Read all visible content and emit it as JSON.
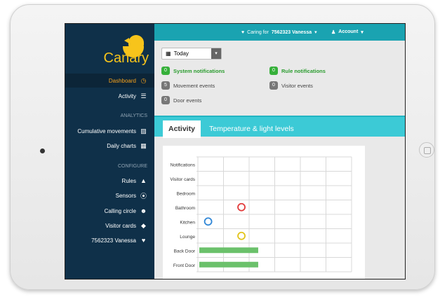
{
  "brand": {
    "name": "Canary",
    "color": "#f7c41b"
  },
  "topbar": {
    "caring_prefix": "Caring for",
    "caring_name": "7562323 Vanessa",
    "account_label": "Account",
    "color": "#1aa3b1"
  },
  "sidebar": {
    "items": [
      {
        "label": "Dashboard",
        "icon": "dashboard-icon"
      },
      {
        "label": "Activity",
        "icon": "activity-bars-icon"
      },
      {
        "label": "Cumulative movements",
        "icon": "line-chart-icon"
      },
      {
        "label": "Daily charts",
        "icon": "calendar-icon"
      },
      {
        "label": "Rules",
        "icon": "bell-icon"
      },
      {
        "label": "Sensors",
        "icon": "sensor-icon"
      },
      {
        "label": "Calling circle",
        "icon": "people-icon"
      },
      {
        "label": "Visitor cards",
        "icon": "tags-icon"
      },
      {
        "label": "7562323 Vanessa",
        "icon": "heart-icon"
      }
    ],
    "headings": {
      "analytics": "ANALYTICS",
      "configure": "CONFIGURE"
    }
  },
  "filters": {
    "date_value": "Today"
  },
  "stats": [
    {
      "count": "0",
      "label": "System notifications",
      "style": "green"
    },
    {
      "count": "0",
      "label": "Rule notifications",
      "style": "green"
    },
    {
      "count": "5",
      "label": "Movement events",
      "style": "gray"
    },
    {
      "count": "0",
      "label": "Visitor events",
      "style": "gray"
    },
    {
      "count": "0",
      "label": "Door events",
      "style": "gray"
    }
  ],
  "tabs": [
    {
      "label": "Activity",
      "active": true
    },
    {
      "label": "Temperature & light levels",
      "active": false
    }
  ],
  "chart_data": {
    "type": "scatter",
    "categories": [
      "Notifications",
      "Visitor cards",
      "Bedroom",
      "Bathroom",
      "Kitchen",
      "Lounge",
      "Back Door",
      "Front Door"
    ],
    "columns": 6,
    "markers": [
      {
        "row": "Bathroom",
        "col": 1.7,
        "color": "#e23b3b"
      },
      {
        "row": "Kitchen",
        "col": 0.4,
        "color": "#2f86d6"
      },
      {
        "row": "Lounge",
        "col": 1.7,
        "color": "#e2c41b"
      }
    ],
    "bars": [
      {
        "row": "Back Door",
        "start": 0,
        "end": 2.3,
        "color": "#6bc16b"
      },
      {
        "row": "Front Door",
        "start": 0,
        "end": 2.3,
        "color": "#6bc16b"
      }
    ]
  }
}
